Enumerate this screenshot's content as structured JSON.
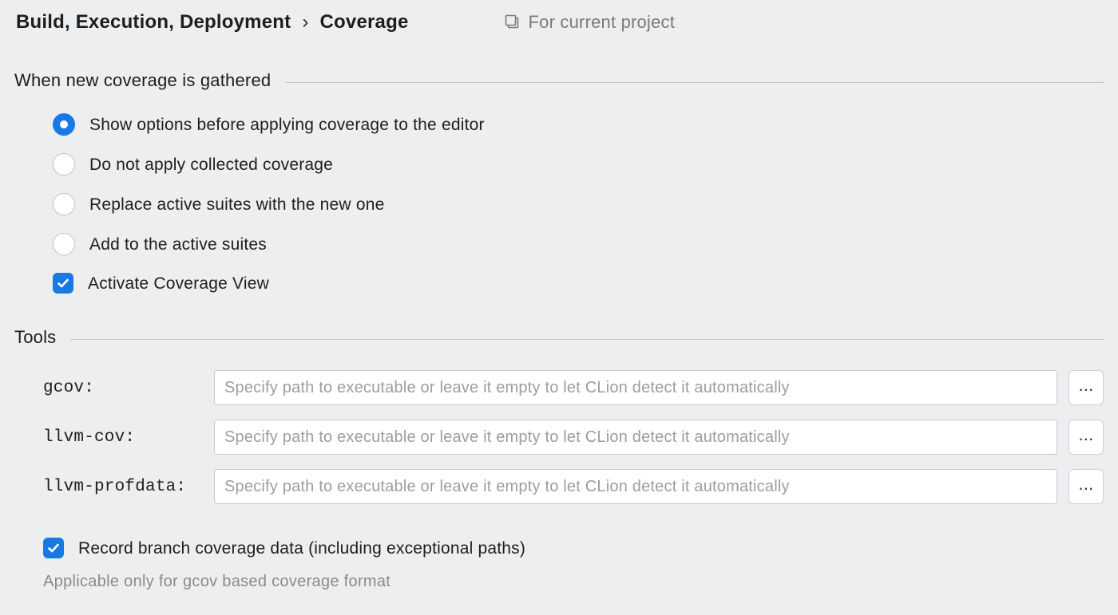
{
  "breadcrumb": {
    "parent": "Build, Execution, Deployment",
    "current": "Coverage"
  },
  "project_indicator": "For current project",
  "sections": {
    "gathered_title": "When new coverage is gathered",
    "tools_title": "Tools"
  },
  "options": {
    "show_options": "Show options before applying coverage to the editor",
    "do_not_apply": "Do not apply collected coverage",
    "replace_suites": "Replace active suites with the new one",
    "add_suites": "Add to the active suites",
    "activate_view": "Activate Coverage View"
  },
  "tools": {
    "gcov_label": "gcov:",
    "llvm_cov_label": "llvm-cov:",
    "llvm_profdata_label": "llvm-profdata:",
    "placeholder": "Specify path to executable or leave it empty to let CLion detect it automatically",
    "browse_label": "..."
  },
  "record_branch": {
    "label": "Record branch coverage data (including exceptional paths)",
    "note": "Applicable only for gcov based coverage format"
  }
}
